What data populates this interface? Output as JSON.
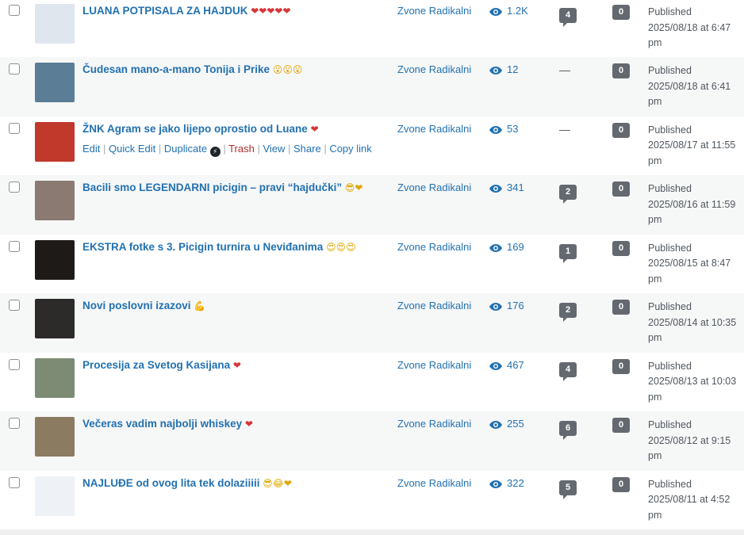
{
  "posts": [
    {
      "title": "LUANA POTPISALA ZA HAJDUK",
      "emoji": "❤❤❤❤❤",
      "emoji_kind": "heart",
      "author": "Zvone Radikalni",
      "views": "1.2K",
      "comments": "4",
      "pending": "0",
      "status": "Published",
      "date": "2025/08/18 at 6:47 pm"
    },
    {
      "title": "Čudesan mano-a-mano Tonija i Prike",
      "emoji": "😮😮😮",
      "emoji_kind": "face",
      "author": "Zvone Radikalni",
      "views": "12",
      "comments": "—",
      "pending": "0",
      "status": "Published",
      "date": "2025/08/18 at 6:41 pm"
    },
    {
      "title": "ŽNK Agram se jako lijepo oprostio od Luane",
      "emoji": "❤",
      "emoji_kind": "heart",
      "author": "Zvone Radikalni",
      "views": "53",
      "comments": "—",
      "pending": "0",
      "status": "Published",
      "date": "2025/08/17 at 11:55 pm"
    },
    {
      "title": "Bacili smo LEGENDARNI picigin – pravi “hajdučki”",
      "emoji": "😎❤",
      "emoji_kind": "mixed",
      "author": "Zvone Radikalni",
      "views": "341",
      "comments": "2",
      "pending": "0",
      "status": "Published",
      "date": "2025/08/16 at 11:59 pm"
    },
    {
      "title": "EKSTRA fotke s 3. Picigin turnira u Neviđanima",
      "emoji": "😍😍😍",
      "emoji_kind": "face",
      "author": "Zvone Radikalni",
      "views": "169",
      "comments": "1",
      "pending": "0",
      "status": "Published",
      "date": "2025/08/15 at 8:47 pm"
    },
    {
      "title": "Novi poslovni izazovi",
      "emoji": "💪",
      "emoji_kind": "face",
      "author": "Zvone Radikalni",
      "views": "176",
      "comments": "2",
      "pending": "0",
      "status": "Published",
      "date": "2025/08/14 at 10:35 pm"
    },
    {
      "title": "Procesija za Svetog Kasijana",
      "emoji": "❤",
      "emoji_kind": "heart",
      "author": "Zvone Radikalni",
      "views": "467",
      "comments": "4",
      "pending": "0",
      "status": "Published",
      "date": "2025/08/13 at 10:03 pm"
    },
    {
      "title": "Večeras vadim najbolji whiskey",
      "emoji": "❤",
      "emoji_kind": "heart",
      "author": "Zvone Radikalni",
      "views": "255",
      "comments": "6",
      "pending": "0",
      "status": "Published",
      "date": "2025/08/12 at 9:15 pm"
    },
    {
      "title": "NAJLUĐE od ovog lita tek dolaziiiii",
      "emoji": "😎😂❤",
      "emoji_kind": "mixed",
      "author": "Zvone Radikalni",
      "views": "322",
      "comments": "5",
      "pending": "0",
      "status": "Published",
      "date": "2025/08/11 at 4:52 pm"
    }
  ],
  "row_actions": {
    "edit": "Edit",
    "quick_edit": "Quick Edit",
    "duplicate": "Duplicate",
    "trash": "Trash",
    "view": "View",
    "share": "Share",
    "copy_link": "Copy link"
  },
  "thumb_colors": [
    "#dfe6ee",
    "#5b7d96",
    "#c0392b",
    "#8a7a72",
    "#1e1a18",
    "#2d2a2a",
    "#7d8b74",
    "#8b7b60",
    "#eef1f5"
  ],
  "colors": {
    "link": "#2271b1",
    "bubble": "#646970",
    "trash": "#b32d2e",
    "alt_row": "#f6f7f7"
  }
}
